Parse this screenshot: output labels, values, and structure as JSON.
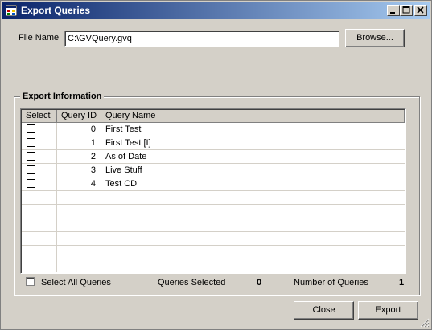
{
  "window": {
    "title": "Export Queries"
  },
  "file": {
    "label": "File Name",
    "value": "C:\\GVQuery.gvq",
    "browse_label": "Browse..."
  },
  "group": {
    "title": "Export Information"
  },
  "table": {
    "headers": [
      "Select",
      "Query ID",
      "Query Name"
    ],
    "rows": [
      {
        "id": "0",
        "name": "First Test",
        "checked": false
      },
      {
        "id": "1",
        "name": "First Test [I]",
        "checked": false
      },
      {
        "id": "2",
        "name": "As of Date",
        "checked": false
      },
      {
        "id": "3",
        "name": "Live Stuff",
        "checked": false
      },
      {
        "id": "4",
        "name": "Test CD",
        "checked": false
      }
    ]
  },
  "footer": {
    "select_all_label": "Select All Queries",
    "queries_selected_label": "Queries Selected",
    "queries_selected_value": "0",
    "number_of_queries_label": "Number of Queries",
    "number_of_queries_value": "1"
  },
  "buttons": {
    "close_label": "Close",
    "export_label": "Export"
  },
  "colors": {
    "title_start": "#0a246a",
    "title_end": "#a6caf0",
    "face": "#d4d0c8"
  }
}
